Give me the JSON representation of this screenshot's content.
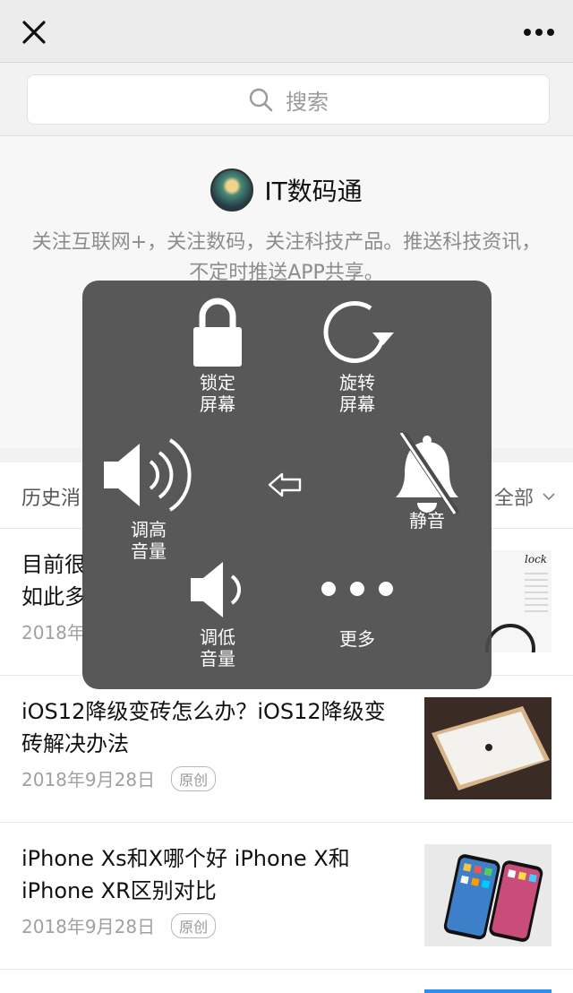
{
  "profile": {
    "name": "IT数码通",
    "description": "关注互联网+，关注数码，关注科技产品。推送科技资讯，不定时推送APP共享。"
  },
  "search": {
    "placeholder": "搜索"
  },
  "history": {
    "title": "历史消",
    "all_label": "全部",
    "articles": [
      {
        "title": "目前很\n如此多",
        "date": "2018年",
        "badge": "",
        "thumb_text": "lock"
      },
      {
        "title": "iOS12降级变砖怎么办？iOS12降级变砖解决办法",
        "date": "2018年9月28日",
        "badge": "原创"
      },
      {
        "title": "iPhone Xs和X哪个好 iPhone X和iPhone XR区别对比",
        "date": "2018年9月28日",
        "badge": "原创"
      }
    ]
  },
  "assistive_menu": {
    "lock_label": "锁定\n屏幕",
    "rotate_label": "旋转\n屏幕",
    "volume_up_label": "调高\n音量",
    "mute_label": "静音",
    "volume_down_label": "调低\n音量",
    "more_label": "更多"
  },
  "colors": {
    "overlay": "#4b4b4b",
    "page_bg": "#f2f2f2",
    "text_muted": "#8c8c8c"
  }
}
